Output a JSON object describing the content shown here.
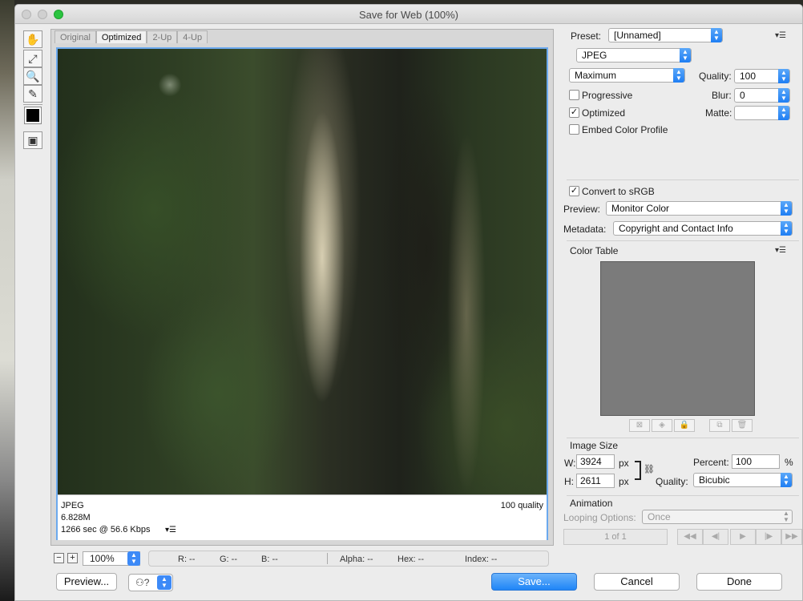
{
  "window": {
    "title": "Save for Web (100%)"
  },
  "tabs": [
    "Original",
    "Optimized",
    "2-Up",
    "4-Up"
  ],
  "preview_info": {
    "format": "JPEG",
    "size": "6.828M",
    "download": "1266 sec @ 56.6 Kbps",
    "quality": "100 quality"
  },
  "status": {
    "zoom": "100%",
    "r": "R: --",
    "g": "G: --",
    "b": "B: --",
    "alpha": "Alpha: --",
    "hex": "Hex: --",
    "index": "Index: --"
  },
  "buttons": {
    "preview": "Preview...",
    "save": "Save...",
    "cancel": "Cancel",
    "done": "Done"
  },
  "settings": {
    "preset_label": "Preset:",
    "preset_value": "[Unnamed]",
    "format": "JPEG",
    "compression": "Maximum",
    "quality_label": "Quality:",
    "quality_value": "100",
    "blur_label": "Blur:",
    "blur_value": "0",
    "matte_label": "Matte:",
    "matte_value": "",
    "progressive": "Progressive",
    "optimized": "Optimized",
    "embed_profile": "Embed Color Profile",
    "convert_srgb": "Convert to sRGB",
    "preview_label": "Preview:",
    "preview_value": "Monitor Color",
    "metadata_label": "Metadata:",
    "metadata_value": "Copyright and Contact Info"
  },
  "checkboxes": {
    "progressive": false,
    "optimized": true,
    "embed_profile": false,
    "convert_srgb": true
  },
  "color_table": {
    "heading": "Color Table",
    "fill": "#7b7b7b"
  },
  "image_size": {
    "heading": "Image Size",
    "w_label": "W:",
    "w_value": "3924",
    "h_label": "H:",
    "h_value": "2611",
    "unit": "px",
    "percent_label": "Percent:",
    "percent_value": "100",
    "percent_unit": "%",
    "quality_label": "Quality:",
    "quality_value": "Bicubic"
  },
  "animation": {
    "heading": "Animation",
    "looping_label": "Looping Options:",
    "looping_value": "Once",
    "frame": "1 of 1"
  },
  "colors": {
    "accent": "#3d8af7",
    "primary_button": "#1f85f7",
    "selection_border": "#6ba9ee"
  }
}
